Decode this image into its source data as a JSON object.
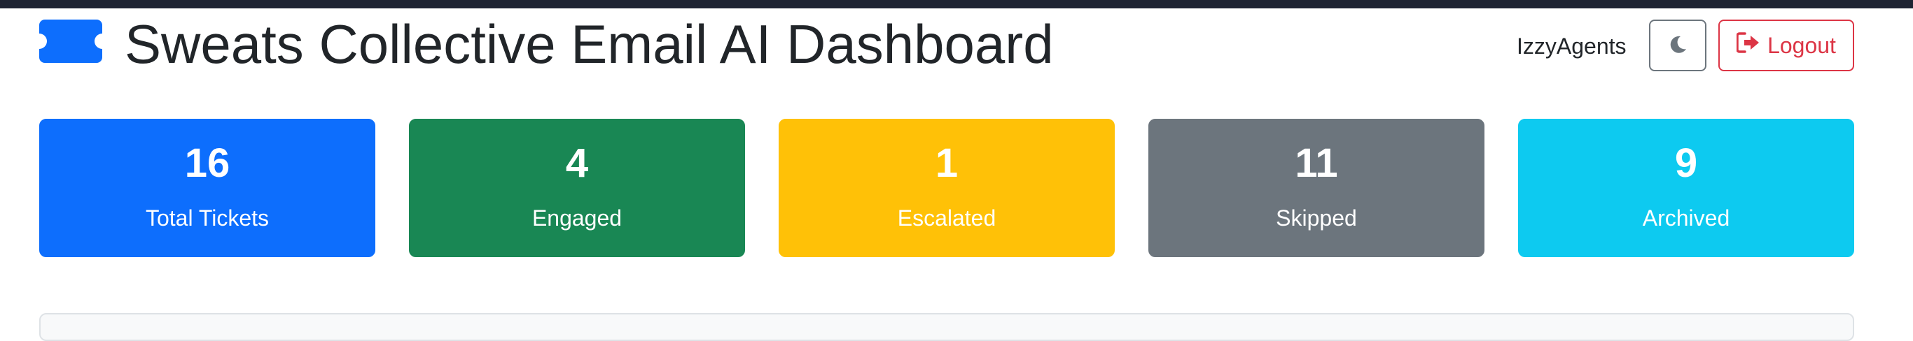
{
  "header": {
    "title": "Sweats Collective Email AI Dashboard",
    "user": "IzzyAgents",
    "logout_label": "Logout",
    "logo_icon": "ticket-icon",
    "theme_icon": "moon-icon",
    "logout_icon": "sign-out-icon"
  },
  "stats": [
    {
      "value": "16",
      "label": "Total Tickets",
      "color": "#0d6efd"
    },
    {
      "value": "4",
      "label": "Engaged",
      "color": "#198754"
    },
    {
      "value": "1",
      "label": "Escalated",
      "color": "#ffc107"
    },
    {
      "value": "11",
      "label": "Skipped",
      "color": "#6c757d"
    },
    {
      "value": "9",
      "label": "Archived",
      "color": "#0dcaf0"
    }
  ],
  "colors": {
    "brand": "#0d6efd",
    "danger": "#dc3545",
    "topbar": "#1f2433"
  }
}
